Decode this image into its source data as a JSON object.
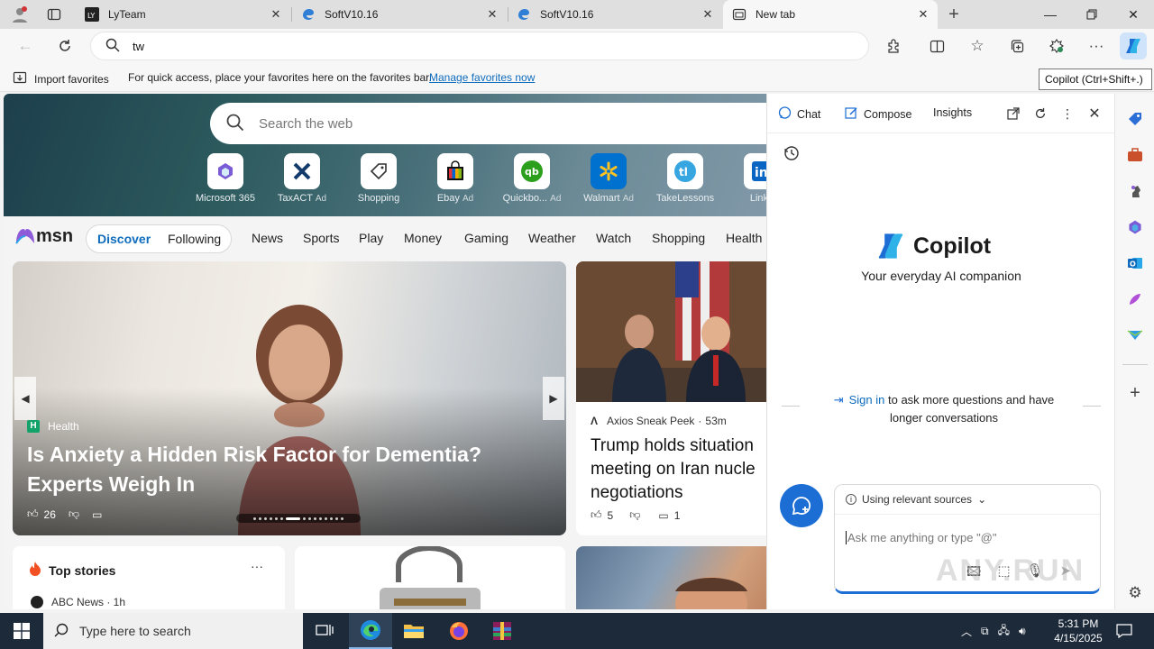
{
  "tabs": [
    {
      "label": "LyTeam"
    },
    {
      "label": "SoftV10.16"
    },
    {
      "label": "SoftV10.16"
    },
    {
      "label": "New tab"
    }
  ],
  "address": {
    "value": "tw"
  },
  "favorites_bar": {
    "import_label": "Import favorites",
    "message": "For quick access, place your favorites here on the favorites bar.",
    "manage_link": "Manage favorites now"
  },
  "tooltip": "Copilot (Ctrl+Shift+.)",
  "search": {
    "placeholder": "Search the web"
  },
  "quick_links": [
    {
      "label": "Microsoft 365",
      "ad": ""
    },
    {
      "label": "TaxACT",
      "ad": "Ad"
    },
    {
      "label": "Shopping",
      "ad": ""
    },
    {
      "label": "Ebay",
      "ad": "Ad"
    },
    {
      "label": "Quickbo...",
      "ad": "Ad"
    },
    {
      "label": "Walmart",
      "ad": "Ad"
    },
    {
      "label": "TakeLessons",
      "ad": ""
    },
    {
      "label": "Linke",
      "ad": ""
    }
  ],
  "msn": {
    "logo": "msn",
    "discover": "Discover",
    "following": "Following",
    "nav": [
      "News",
      "Sports",
      "Play",
      "Money",
      "Gaming",
      "Weather",
      "Watch",
      "Shopping",
      "Health"
    ]
  },
  "hero": {
    "category": "Health",
    "title": "Is Anxiety a Hidden Risk Factor for Dementia? Experts Weigh In",
    "likes": "26"
  },
  "side_story": {
    "source": "Axios Sneak Peek",
    "age": "53m",
    "title_lines": [
      "Trump holds situation",
      "meeting on Iran nucle",
      "negotiations"
    ],
    "likes": "5",
    "comments": "1"
  },
  "top_stories": {
    "heading": "Top stories",
    "more": "···",
    "source": "ABC News · 1h"
  },
  "copilot": {
    "tabs": [
      "Chat",
      "Compose",
      "Insights"
    ],
    "name": "Copilot",
    "tagline": "Your everyday AI companion",
    "sign_in": "Sign in",
    "sign_in_rest": "to ask more questions and have longer conversations",
    "sources": "Using relevant sources",
    "placeholder": "Ask me anything or type \"@\""
  },
  "taskbar": {
    "search_placeholder": "Type here to search",
    "time": "5:31 PM",
    "date": "4/15/2025"
  },
  "watermark": "ANY.RUN",
  "colors": {
    "accent": "#0f6cbd",
    "copilot_blue": "#1c6ed4",
    "taskbar": "#1c2a3a"
  }
}
